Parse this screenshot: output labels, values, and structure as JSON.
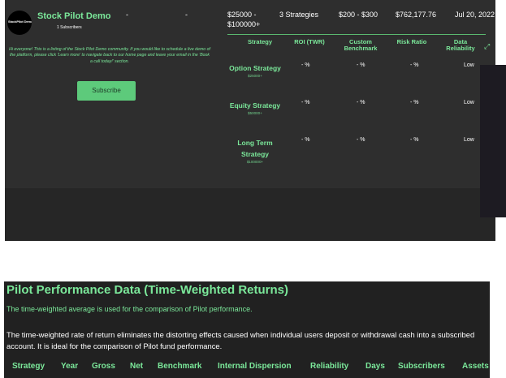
{
  "listing": {
    "logo_text": "StockPilot Demo",
    "title": "Stock Pilot Demo",
    "subscribers": "1 Subscribers",
    "col1": "-",
    "col2": "-",
    "minimum": "$25000 - $100000+",
    "strategies_count": "3 Strategies",
    "price": "$200 - $300",
    "assets": "$762,177.76",
    "date": "Jul 20, 2022",
    "description": "Hi everyone! This is a listing of the Stock Pilot Demo community. If you would like to schedule a live demo of the platform, please click 'Learn more' to navigate back to our home page and leave your email in the 'Book a call today!' section.",
    "subscribe_label": "Subscribe"
  },
  "strategy_table": {
    "headers": [
      "Strategy",
      "ROI (TWR)",
      "Custom Benchmark",
      "Risk Ratio",
      "Data Reliability"
    ],
    "rows": [
      {
        "name": "Option Strategy",
        "min": "$25000+",
        "roi": "- %",
        "benchmark": "- %",
        "risk": "- %",
        "reliability": "Low"
      },
      {
        "name": "Equity Strategy",
        "min": "$50000+",
        "roi": "- %",
        "benchmark": "- %",
        "risk": "- %",
        "reliability": "Low"
      },
      {
        "name": "Long Term Strategy",
        "min": "$100000+",
        "roi": "- %",
        "benchmark": "- %",
        "risk": "- %",
        "reliability": "Low"
      }
    ]
  },
  "performance": {
    "title": "Pilot Performance Data (Time-Weighted Returns)",
    "subtitle": "The time-weighted average is used for the comparison of Pilot performance.",
    "body": "The time-weighted rate of return eliminates the distorting effects caused when individual users deposit or withdrawal cash into a subscribed account. It is ideal for the comparison of Pilot fund performance.",
    "headers": [
      "Strategy",
      "Year",
      "Gross",
      "Net",
      "Benchmark",
      "Internal Dispersion",
      "Reliability",
      "Days",
      "Subscribers",
      "Assets"
    ]
  },
  "colors": {
    "accent": "#7be89a",
    "button": "#5dca7b",
    "card": "#2e2e2e",
    "panel": "#212121"
  }
}
